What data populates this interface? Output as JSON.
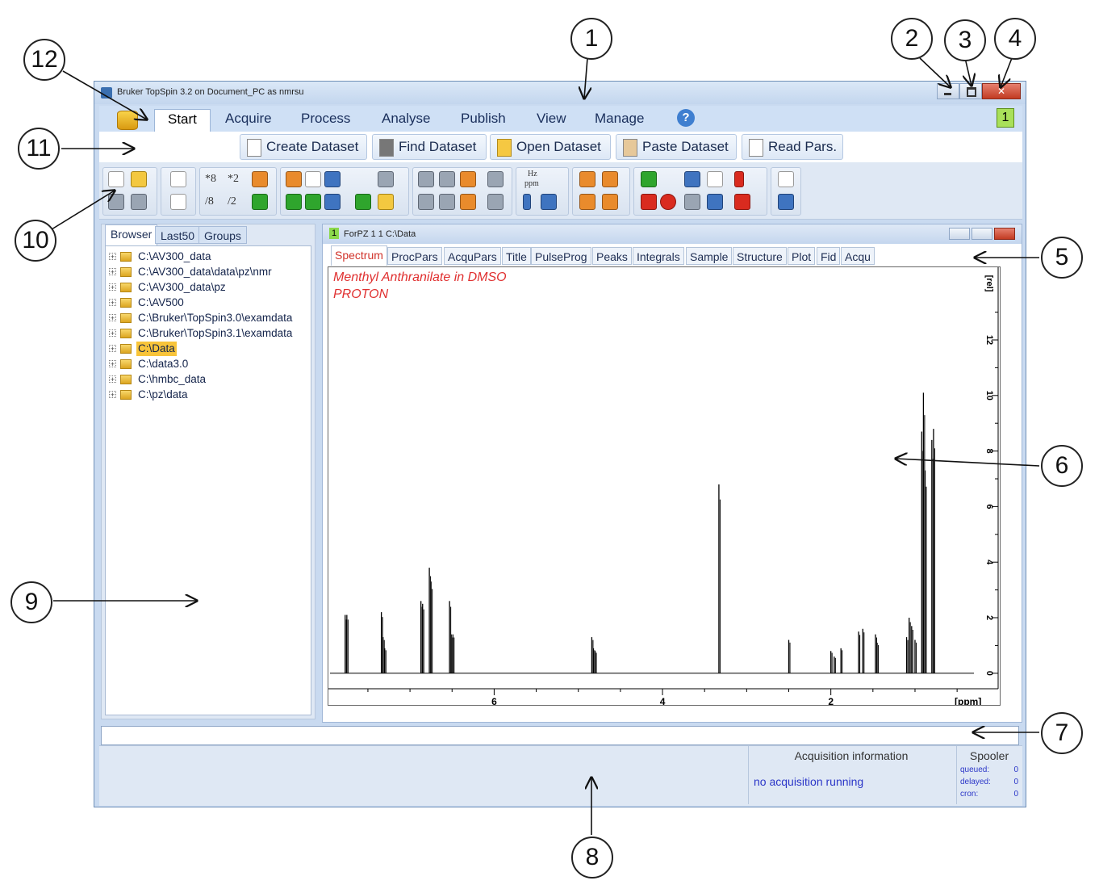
{
  "window": {
    "title": "Bruker TopSpin 3.2 on Document_PC as nmrsu"
  },
  "menu": {
    "items": [
      {
        "label": "Start",
        "active": true
      },
      {
        "label": "Acquire"
      },
      {
        "label": "Process"
      },
      {
        "label": "Analyse"
      },
      {
        "label": "Publish"
      },
      {
        "label": "View"
      },
      {
        "label": "Manage"
      }
    ],
    "window_number": "1",
    "help_icon": "?"
  },
  "command_bar": {
    "buttons": [
      {
        "label": "Create Dataset",
        "icon": "new-file-icon"
      },
      {
        "label": "Find Dataset",
        "icon": "database-icon"
      },
      {
        "label": "Open Dataset",
        "icon": "folder-icon"
      },
      {
        "label": "Paste Dataset",
        "icon": "paste-icon"
      },
      {
        "label": "Read Pars.",
        "icon": "document-icon"
      }
    ]
  },
  "toolbar": {
    "labels": {
      "mul8": "*8",
      "mul2": "*2",
      "div8": "/8",
      "div2": "/2",
      "hz": "Hz",
      "ppm": "ppm"
    }
  },
  "browser": {
    "tabs": [
      {
        "label": "Browser",
        "active": true
      },
      {
        "label": "Last50"
      },
      {
        "label": "Groups"
      }
    ],
    "tree": [
      {
        "label": "C:\\AV300_data"
      },
      {
        "label": "C:\\AV300_data\\data\\pz\\nmr"
      },
      {
        "label": "C:\\AV300_data\\pz"
      },
      {
        "label": "C:\\AV500"
      },
      {
        "label": "C:\\Bruker\\TopSpin3.0\\examdata"
      },
      {
        "label": "C:\\Bruker\\TopSpin3.1\\examdata"
      },
      {
        "label": "C:\\Data",
        "selected": true
      },
      {
        "label": "C:\\data3.0"
      },
      {
        "label": "C:\\hmbc_data"
      },
      {
        "label": "C:\\pz\\data"
      }
    ]
  },
  "dataset": {
    "number": "1",
    "title": "ForPZ  1  1  C:\\Data",
    "tabs": [
      {
        "label": "Spectrum",
        "active": true
      },
      {
        "label": "ProcPars"
      },
      {
        "label": "AcquPars"
      },
      {
        "label": "Title"
      },
      {
        "label": "PulseProg"
      },
      {
        "label": "Peaks"
      },
      {
        "label": "Integrals"
      },
      {
        "label": "Sample"
      },
      {
        "label": "Structure"
      },
      {
        "label": "Plot"
      },
      {
        "label": "Fid"
      },
      {
        "label": "Acqu"
      }
    ],
    "annotation_line1": "Menthyl Anthranilate in DMSO",
    "annotation_line2": "PROTON"
  },
  "spectrum": {
    "x_unit": "[ppm]",
    "y_unit": "[rel]",
    "x_ticks": [
      "6",
      "4",
      "2"
    ],
    "y_ticks": [
      "0",
      "2",
      "4",
      "6",
      "8",
      "10",
      "12"
    ],
    "x_range_ppm": [
      7.95,
      0.3
    ],
    "y_range_rel": [
      -0.5,
      14.5
    ],
    "peaks": [
      {
        "ppm": 7.77,
        "height": 2.1
      },
      {
        "ppm": 7.75,
        "height": 2.1
      },
      {
        "ppm": 7.34,
        "height": 2.2
      },
      {
        "ppm": 7.32,
        "height": 1.3
      },
      {
        "ppm": 7.3,
        "height": 0.9
      },
      {
        "ppm": 6.87,
        "height": 2.6
      },
      {
        "ppm": 6.85,
        "height": 2.5
      },
      {
        "ppm": 6.77,
        "height": 3.8
      },
      {
        "ppm": 6.75,
        "height": 3.3
      },
      {
        "ppm": 6.53,
        "height": 2.6
      },
      {
        "ppm": 6.51,
        "height": 1.4
      },
      {
        "ppm": 6.49,
        "height": 1.4
      },
      {
        "ppm": 4.84,
        "height": 1.3
      },
      {
        "ppm": 4.82,
        "height": 0.9
      },
      {
        "ppm": 4.8,
        "height": 0.8
      },
      {
        "ppm": 3.33,
        "height": 6.8
      },
      {
        "ppm": 2.5,
        "height": 1.2
      },
      {
        "ppm": 2.0,
        "height": 0.8
      },
      {
        "ppm": 1.96,
        "height": 0.6
      },
      {
        "ppm": 1.88,
        "height": 0.9
      },
      {
        "ppm": 1.67,
        "height": 1.5
      },
      {
        "ppm": 1.62,
        "height": 1.6
      },
      {
        "ppm": 1.47,
        "height": 1.4
      },
      {
        "ppm": 1.45,
        "height": 1.1
      },
      {
        "ppm": 1.1,
        "height": 1.3
      },
      {
        "ppm": 1.07,
        "height": 2.0
      },
      {
        "ppm": 1.04,
        "height": 1.7
      },
      {
        "ppm": 1.0,
        "height": 1.2
      },
      {
        "ppm": 0.92,
        "height": 8.7
      },
      {
        "ppm": 0.9,
        "height": 10.1
      },
      {
        "ppm": 0.88,
        "height": 7.3
      },
      {
        "ppm": 0.8,
        "height": 8.4
      },
      {
        "ppm": 0.78,
        "height": 8.8
      }
    ]
  },
  "status": {
    "acquisition_title": "Acquisition information",
    "acquisition_text": "no acquisition running",
    "spooler_title": "Spooler",
    "spooler": [
      {
        "label": "queued:",
        "value": "0"
      },
      {
        "label": "delayed:",
        "value": "0"
      },
      {
        "label": "cron:",
        "value": "0"
      }
    ]
  },
  "callouts": [
    {
      "number": "1"
    },
    {
      "number": "2"
    },
    {
      "number": "3"
    },
    {
      "number": "4"
    },
    {
      "number": "5"
    },
    {
      "number": "6"
    },
    {
      "number": "7"
    },
    {
      "number": "8"
    },
    {
      "number": "9"
    },
    {
      "number": "10"
    },
    {
      "number": "11"
    },
    {
      "number": "12"
    }
  ]
}
